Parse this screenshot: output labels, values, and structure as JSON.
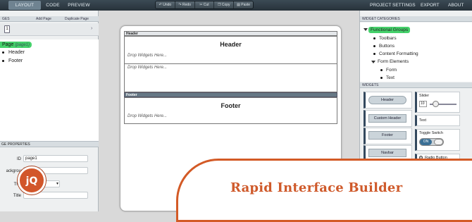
{
  "topbar": {
    "tabs": [
      "LAYOUT",
      "CODE",
      "PREVIEW"
    ],
    "active_tab": "LAYOUT",
    "tools": [
      "Undo",
      "Redo",
      "Cut",
      "Copy",
      "Paste"
    ],
    "right": [
      "PROJECT SETTINGS",
      "EXPORT",
      "ABOUT"
    ]
  },
  "left": {
    "header_partial": "GES",
    "add_page": "Add Page",
    "duplicate_page": "Duplicate Page",
    "page_box": "1",
    "tree": {
      "page_label": "Page",
      "page_id": "(page1)",
      "items": [
        "Header",
        "Footer"
      ]
    },
    "props": {
      "header_partial": "GE PROPERTIES",
      "fields": [
        {
          "label": "ID",
          "value": "page1"
        },
        {
          "label": "ackgrou",
          "value": ""
        },
        {
          "label": "The",
          "value": ""
        },
        {
          "label": "Title",
          "value": ""
        }
      ]
    }
  },
  "canvas": {
    "header_section": "Header",
    "header_title": "Header",
    "drop_text": "Drop Widgets Here...",
    "footer_section": "Footer",
    "footer_title": "Footer"
  },
  "right": {
    "categories_head": "WIDGET CATEGORIES",
    "category_group": "Functional Groups",
    "category_items": [
      "Toolbars",
      "Buttons",
      "Content Formatting"
    ],
    "form_elements": "Form Elements",
    "form_children": [
      "Form",
      "Text"
    ],
    "widgets_head": "WIDGETS",
    "widget_buttons": [
      "Header",
      "Custom Header",
      "Footer",
      "Navbar"
    ],
    "widget_cards": [
      {
        "title": "Slider",
        "value": "10"
      },
      {
        "title": "Text"
      },
      {
        "title": "Toggle Switch",
        "toggle": "ON"
      },
      {
        "title": "Radio Button"
      }
    ]
  },
  "banner": {
    "title": "Rapid Interface Builder",
    "logo": "jQ"
  },
  "colors": {
    "accent": "#d35a26",
    "selection": "#45d16b",
    "topbar": "#27323a"
  }
}
